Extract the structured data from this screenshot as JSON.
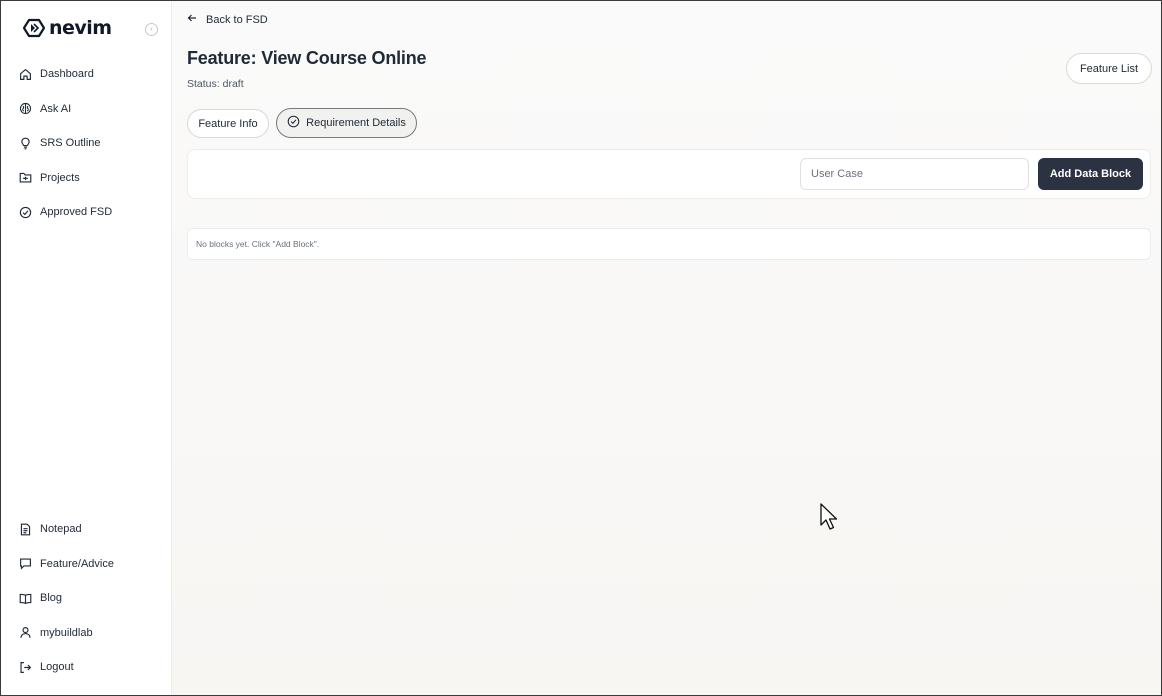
{
  "app": {
    "logo_text": "nevim"
  },
  "sidebar": {
    "top_items": [
      {
        "label": "Dashboard",
        "icon": "home-icon"
      },
      {
        "label": "Ask AI",
        "icon": "brain-icon"
      },
      {
        "label": "SRS Outline",
        "icon": "lightbulb-icon"
      },
      {
        "label": "Projects",
        "icon": "folder-icon"
      },
      {
        "label": "Approved FSD",
        "icon": "check-circle-icon"
      }
    ],
    "bottom_items": [
      {
        "label": "Notepad",
        "icon": "document-icon"
      },
      {
        "label": "Feature/Advice",
        "icon": "message-icon"
      },
      {
        "label": "Blog",
        "icon": "book-icon"
      },
      {
        "label": "mybuildlab",
        "icon": "user-icon"
      },
      {
        "label": "Logout",
        "icon": "logout-icon"
      }
    ]
  },
  "header": {
    "back_label": "Back to FSD",
    "title": "Feature: View Course Online",
    "status": "Status: draft",
    "feature_list_label": "Feature List"
  },
  "tabs": [
    {
      "label": "Feature Info"
    },
    {
      "label": "Requirement Details",
      "selected": true
    }
  ],
  "toolbar": {
    "usercase_placeholder": "User Case",
    "add_button_label": "Add Data Block"
  },
  "blocks": {
    "empty_message": "No blocks yet. Click \"Add Block\"."
  },
  "colors": {
    "primary_button": "#2b3342",
    "background": "#f9f8f6"
  }
}
